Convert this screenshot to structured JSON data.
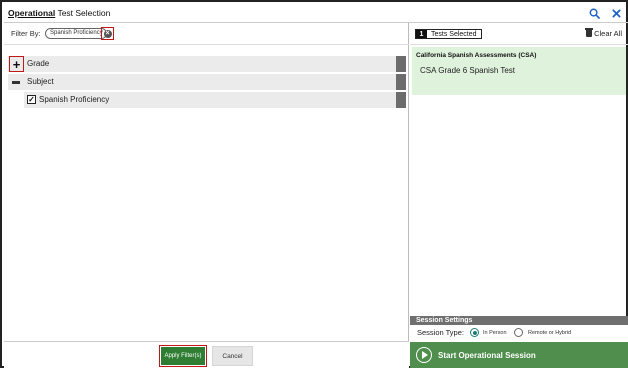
{
  "title": {
    "strong": "Operational",
    "rest": " Test Selection"
  },
  "title_icons": [
    "search-icon",
    "close-icon"
  ],
  "filter": {
    "label": "Filter By:",
    "chips": [
      {
        "label": "Spanish Proficiency"
      }
    ],
    "remove_glyph": "×"
  },
  "tree": {
    "items": [
      {
        "label": "Grade",
        "state": "collapsed",
        "glyph": "+"
      },
      {
        "label": "Subject",
        "state": "expanded"
      },
      {
        "label": "Spanish Proficiency",
        "checked": true,
        "check_glyph": "✓"
      }
    ]
  },
  "buttons": {
    "apply": "Apply Filter(s)",
    "cancel": "Cancel"
  },
  "selected": {
    "count": "1",
    "label": "Tests Selected",
    "clear_all": "Clear All",
    "group_title": "California Spanish Assessments (CSA)",
    "tests": [
      "CSA Grade 6 Spanish Test"
    ]
  },
  "session": {
    "header": "Session Settings",
    "type_label": "Session Type:",
    "options": [
      {
        "label": "In Person",
        "selected": true
      },
      {
        "label": "Remote or Hybrid",
        "selected": false
      }
    ]
  },
  "start_button": "Start Operational Session",
  "colors": {
    "accent_blue": "#1f62c7",
    "primary_green": "#2e7d32",
    "start_green": "#4f8e4d",
    "selected_bg": "#dff3dc",
    "highlight_red": "#c01818",
    "radio_teal": "#1d7d78"
  }
}
